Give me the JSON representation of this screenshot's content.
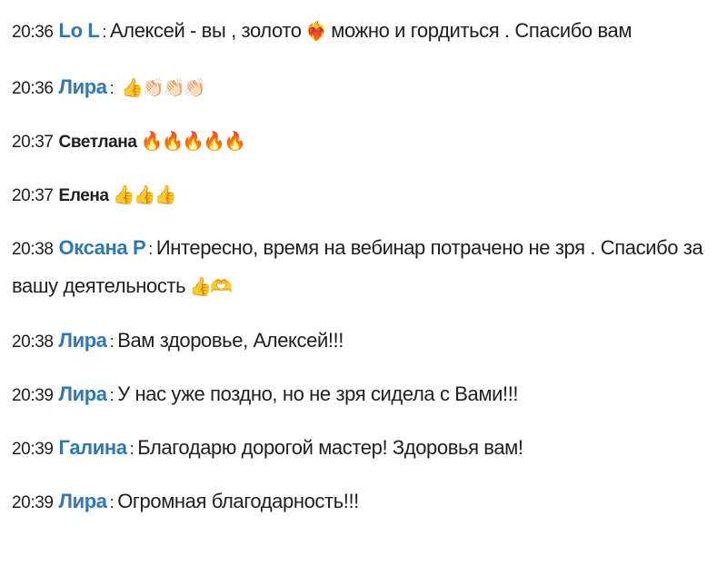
{
  "messages": [
    {
      "time": "20:36",
      "author": "Lo L",
      "sep": ":",
      "text": "Алексей - вы , золото",
      "emoji": "❤️‍🔥",
      "text2": " можно и гордиться . Спасибо вам",
      "name_color": "blue"
    },
    {
      "time": "20:36",
      "author": "Лира",
      "sep": ":",
      "text": "",
      "emoji": "👍👏🏻👏🏻👏🏻",
      "text2": "",
      "name_color": "blue"
    },
    {
      "time": "20:37",
      "author": "Светлана",
      "sep": "",
      "text": "",
      "emoji": "🔥🔥🔥🔥🔥",
      "text2": "",
      "name_color": "dark"
    },
    {
      "time": "20:37",
      "author": "Елена",
      "sep": "",
      "text": "",
      "emoji": "👍👍👍",
      "text2": "",
      "name_color": "dark"
    },
    {
      "time": "20:38",
      "author": "Оксана Р",
      "sep": ":",
      "text": "Интересно, время на вебинар потрачено не зря . Спасибо за вашу деятельность",
      "emoji": "👍🫶",
      "text2": "",
      "name_color": "blue"
    },
    {
      "time": "20:38",
      "author": "Лира",
      "sep": ":",
      "text": "Вам здоровье, Алексей!!!",
      "emoji": "",
      "text2": "",
      "name_color": "blue"
    },
    {
      "time": "20:39",
      "author": "Лира",
      "sep": ":",
      "text": "У нас уже поздно, но не зря сидела с Вами!!!",
      "emoji": "",
      "text2": "",
      "name_color": "blue"
    },
    {
      "time": "20:39",
      "author": "Галина",
      "sep": ":",
      "text": "Благодарю дорогой мастер! Здоровья вам!",
      "emoji": "",
      "text2": "",
      "name_color": "blue"
    },
    {
      "time": "20:39",
      "author": "Лира",
      "sep": ":",
      "text": "Огромная благодарность!!!",
      "emoji": "",
      "text2": "",
      "name_color": "blue"
    }
  ],
  "colors": {
    "author_blue": "#2f78b7",
    "text": "#1f1f1f",
    "background": "#ffffff"
  }
}
